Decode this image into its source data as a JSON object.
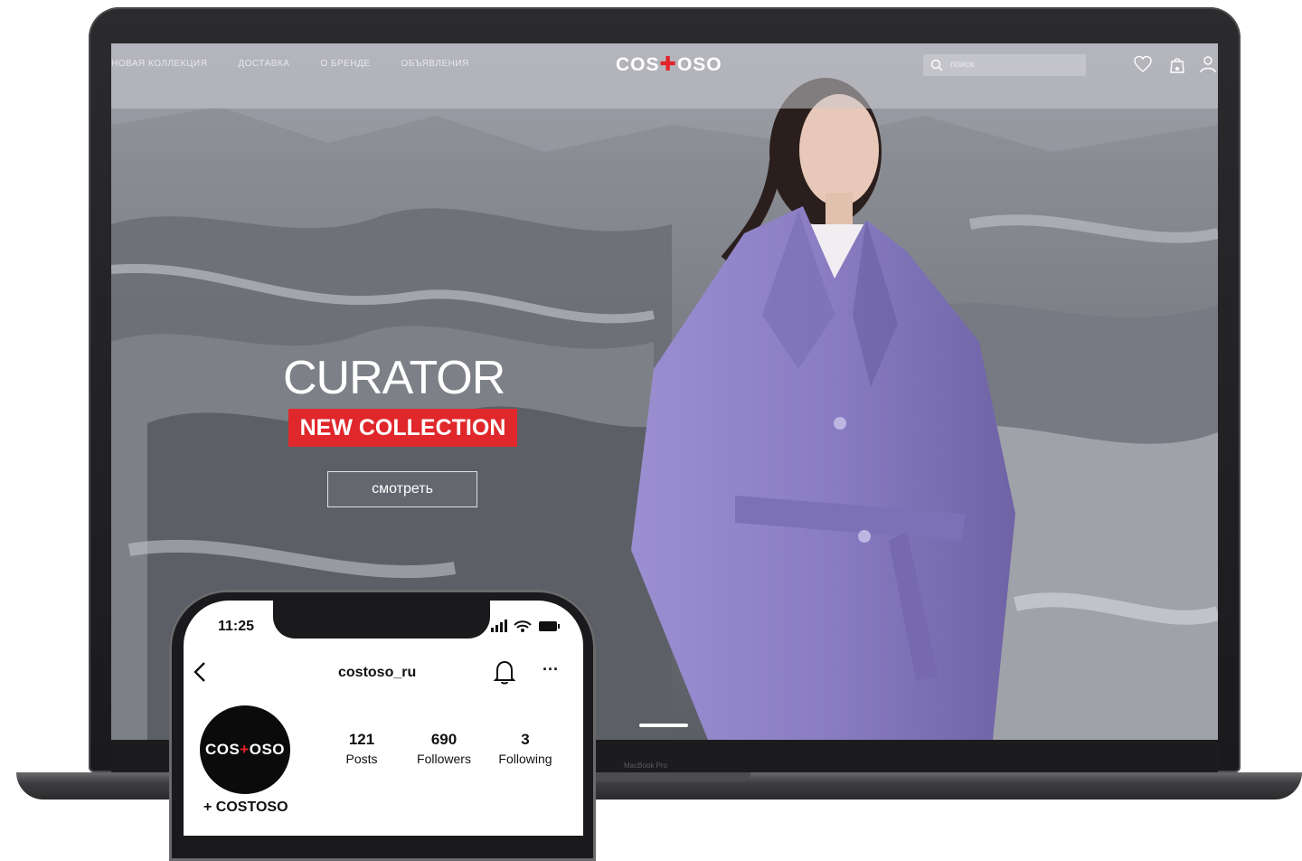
{
  "website": {
    "nav": [
      "новая коллекция",
      "доставка",
      "о бренде",
      "объявления"
    ],
    "logo": {
      "left": "COS",
      "right": "OSO"
    },
    "search_placeholder": "поиск",
    "hero": {
      "title": "CURATOR",
      "badge": "NEW COLLECTION",
      "button": "смотреть"
    }
  },
  "laptop": {
    "bezel_label": "MacBook Pro"
  },
  "phone": {
    "status_time": "11:25",
    "profile": {
      "username": "costoso_ru",
      "avatar_text": {
        "left": "COS",
        "right": "OSO"
      },
      "brand_line": "+ COSTOSO",
      "stats": [
        {
          "value": "121",
          "label": "Posts"
        },
        {
          "value": "690",
          "label": "Followers"
        },
        {
          "value": "3",
          "label": "Following"
        }
      ]
    }
  },
  "colors": {
    "brand_red": "#e0272b",
    "coat_purple": "#8d80c4"
  }
}
